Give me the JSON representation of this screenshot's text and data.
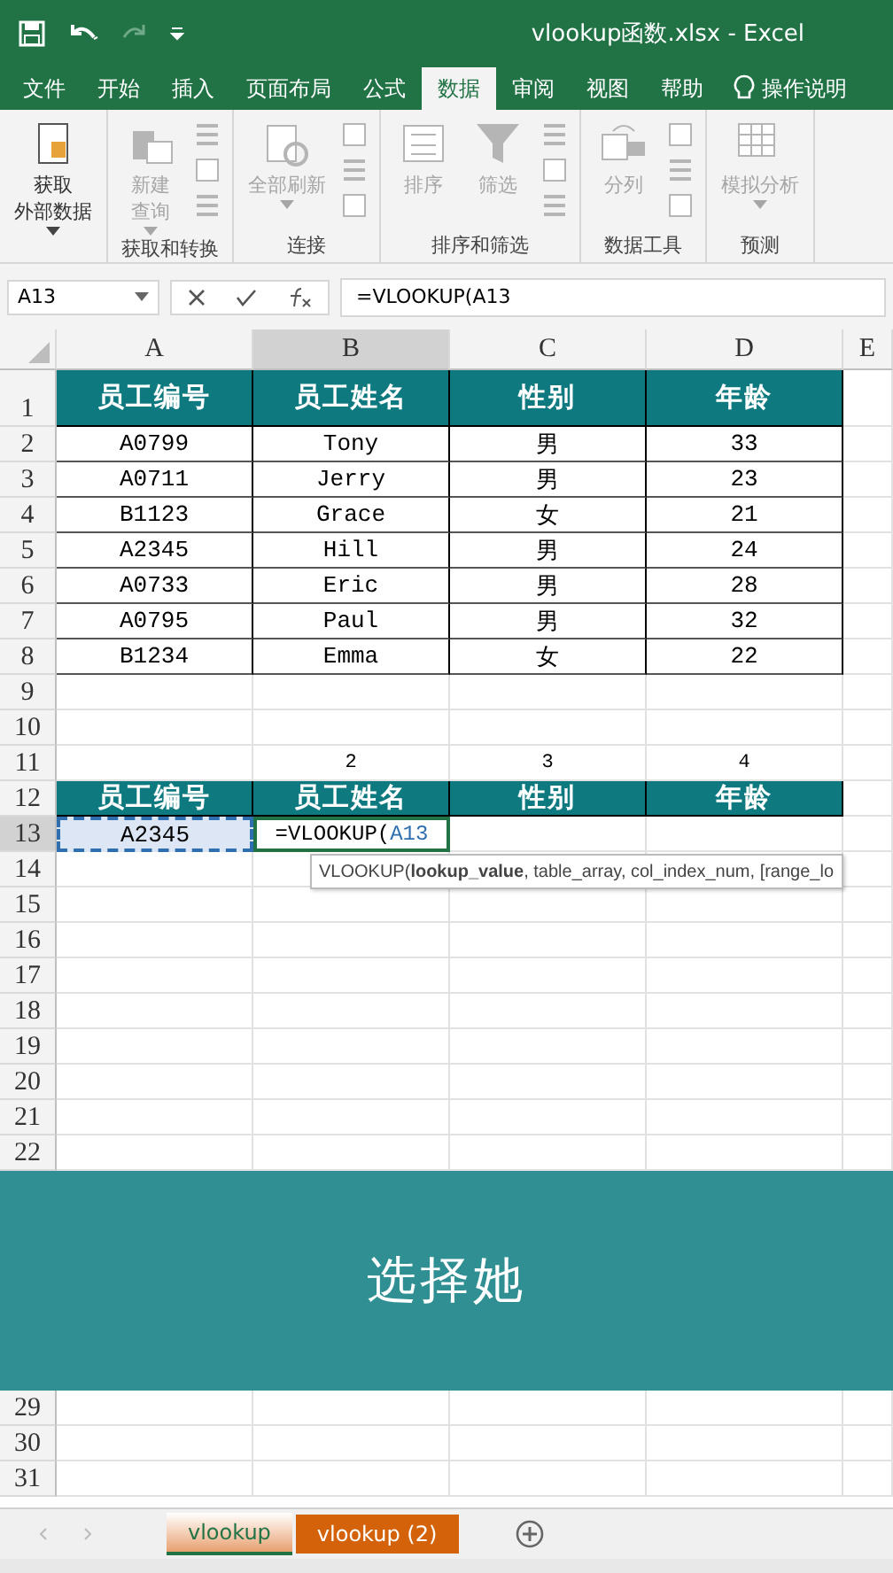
{
  "window": {
    "title": "vlookup函数.xlsx  -  Excel"
  },
  "ribbon_tabs": [
    {
      "label": "文件",
      "selected": false
    },
    {
      "label": "开始",
      "selected": false
    },
    {
      "label": "插入",
      "selected": false
    },
    {
      "label": "页面布局",
      "selected": false
    },
    {
      "label": "公式",
      "selected": false
    },
    {
      "label": "数据",
      "selected": true
    },
    {
      "label": "审阅",
      "selected": false
    },
    {
      "label": "视图",
      "selected": false
    },
    {
      "label": "帮助",
      "selected": false
    }
  ],
  "tell_me": "操作说明",
  "ribbon_groups": [
    {
      "buttons": [
        {
          "lines": [
            "获取",
            "外部数据"
          ],
          "dropdown": true,
          "disabled": false
        }
      ]
    },
    {
      "label": "获取和转换",
      "buttons": [
        {
          "lines": [
            "新建",
            "查询"
          ],
          "dropdown": true,
          "disabled": true
        }
      ]
    },
    {
      "label": "连接",
      "buttons": [
        {
          "lines": [
            "全部刷新"
          ],
          "dropdown": true,
          "disabled": true
        }
      ]
    },
    {
      "label": "排序和筛选",
      "buttons": [
        {
          "lines": [
            "排序"
          ],
          "dropdown": false,
          "disabled": true
        },
        {
          "lines": [
            "筛选"
          ],
          "dropdown": false,
          "disabled": true
        }
      ]
    },
    {
      "label": "数据工具",
      "buttons": [
        {
          "lines": [
            "分列"
          ],
          "dropdown": false,
          "disabled": true
        }
      ]
    },
    {
      "label": "预测",
      "buttons": [
        {
          "lines": [
            "模拟分析"
          ],
          "dropdown": true,
          "disabled": true
        }
      ]
    }
  ],
  "formula_bar": {
    "name_box": "A13",
    "formula": "=VLOOKUP(A13"
  },
  "columns": [
    {
      "label": "A",
      "selected": false
    },
    {
      "label": "B",
      "selected": true
    },
    {
      "label": "C",
      "selected": false
    },
    {
      "label": "D",
      "selected": false
    },
    {
      "label": "E",
      "selected": false
    }
  ],
  "rows": [
    {
      "label": "1",
      "kind": "header",
      "selected": false,
      "cells": [
        "员工编号",
        "员工姓名",
        "性别",
        "年龄"
      ]
    },
    {
      "label": "2",
      "kind": "data",
      "selected": false,
      "cells": [
        "A0799",
        "Tony",
        "男",
        "33"
      ]
    },
    {
      "label": "3",
      "kind": "data",
      "selected": false,
      "cells": [
        "A0711",
        "Jerry",
        "男",
        "23"
      ]
    },
    {
      "label": "4",
      "kind": "data",
      "selected": false,
      "cells": [
        "B1123",
        "Grace",
        "女",
        "21"
      ]
    },
    {
      "label": "5",
      "kind": "data",
      "selected": false,
      "cells": [
        "A2345",
        "Hill",
        "男",
        "24"
      ]
    },
    {
      "label": "6",
      "kind": "data",
      "selected": false,
      "cells": [
        "A0733",
        "Eric",
        "男",
        "28"
      ]
    },
    {
      "label": "7",
      "kind": "data",
      "selected": false,
      "cells": [
        "A0795",
        "Paul",
        "男",
        "32"
      ]
    },
    {
      "label": "8",
      "kind": "data",
      "selected": false,
      "cells": [
        "B1234",
        "Emma",
        "女",
        "22"
      ]
    },
    {
      "label": "9",
      "kind": "plain",
      "selected": false
    },
    {
      "label": "10",
      "kind": "plain",
      "selected": false
    },
    {
      "label": "11",
      "kind": "plain",
      "selected": false,
      "cells": [
        null,
        "2",
        "3",
        "4"
      ]
    },
    {
      "label": "12",
      "kind": "header",
      "selected": false,
      "cells": [
        "员工编号",
        "员工姓名",
        "性别",
        "年龄"
      ]
    },
    {
      "label": "13",
      "kind": "entry",
      "selected": true,
      "lookup": "A2345",
      "formula": "=VLOOKUP(",
      "ref": "A13"
    },
    {
      "label": "14",
      "kind": "plain",
      "selected": false
    },
    {
      "label": "15",
      "kind": "plain",
      "selected": false
    },
    {
      "label": "16",
      "kind": "plain",
      "selected": false
    },
    {
      "label": "17",
      "kind": "plain",
      "selected": false
    },
    {
      "label": "18",
      "kind": "plain",
      "selected": false
    },
    {
      "label": "19",
      "kind": "plain",
      "selected": false
    },
    {
      "label": "20",
      "kind": "plain",
      "selected": false
    },
    {
      "label": "21",
      "kind": "plain",
      "selected": false
    },
    {
      "label": "22",
      "kind": "plain",
      "selected": false
    },
    {
      "kind": "caption",
      "text": "选择她"
    },
    {
      "label": "29",
      "kind": "plain",
      "selected": false
    },
    {
      "label": "30",
      "kind": "plain",
      "selected": false
    },
    {
      "label": "31",
      "kind": "plain",
      "selected": false
    }
  ],
  "tooltip": "VLOOKUP(**lookup_value**, table_array, col_index_num, [range_lo",
  "sheet_tabs": [
    {
      "label": "vlookup",
      "selected": true,
      "color": "#e8a070"
    },
    {
      "label": "vlookup (2)",
      "selected": false,
      "color": "#d4620a"
    }
  ]
}
